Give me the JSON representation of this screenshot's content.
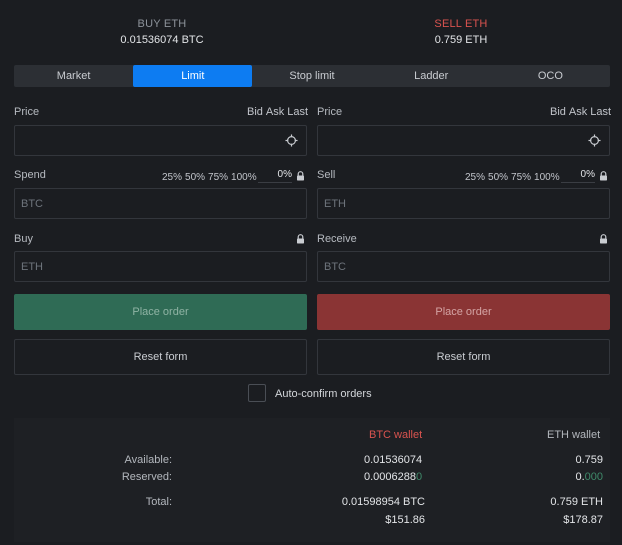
{
  "header": {
    "buy_title": "BUY ETH",
    "buy_amount": "0.01536074 BTC",
    "sell_title": "SELL ETH",
    "sell_amount": "0.759 ETH"
  },
  "tabs": [
    "Market",
    "Limit",
    "Stop limit",
    "Ladder",
    "OCO"
  ],
  "active_tab": "Limit",
  "buy_form": {
    "price_label": "Price",
    "price_links": [
      "Bid",
      "Ask",
      "Last"
    ],
    "spend_label": "Spend",
    "percents": [
      "25%",
      "50%",
      "75%",
      "100%"
    ],
    "percent_value": "0",
    "percent_sign": "%",
    "spend_placeholder": "BTC",
    "receive_label": "Buy",
    "receive_placeholder": "ETH",
    "place_label": "Place order",
    "reset_label": "Reset form"
  },
  "sell_form": {
    "price_label": "Price",
    "price_links": [
      "Bid",
      "Ask",
      "Last"
    ],
    "spend_label": "Sell",
    "percents": [
      "25%",
      "50%",
      "75%",
      "100%"
    ],
    "percent_value": "0",
    "percent_sign": "%",
    "spend_placeholder": "ETH",
    "receive_label": "Receive",
    "receive_placeholder": "BTC",
    "place_label": "Place order",
    "reset_label": "Reset form"
  },
  "auto_confirm_label": "Auto-confirm orders",
  "summary": {
    "btc_wallet_label": "BTC wallet",
    "eth_wallet_label": "ETH wallet",
    "available_label": "Available:",
    "reserved_label": "Reserved:",
    "total_label": "Total:",
    "btc_available": "0.01536074",
    "btc_reserved_main": "0.0006288",
    "btc_reserved_tail": "0",
    "btc_total": "0.01598954 BTC",
    "btc_total_usd": "$151.86",
    "eth_available": "0.759",
    "eth_reserved_main": "0.",
    "eth_reserved_tail": "000",
    "eth_total": "0.759 ETH",
    "eth_total_usd": "$178.87"
  },
  "colors": {
    "accent": "#0d7cf2",
    "buy": "#2f6b55",
    "sell": "#8a3434",
    "sell_text": "#d9534f"
  }
}
